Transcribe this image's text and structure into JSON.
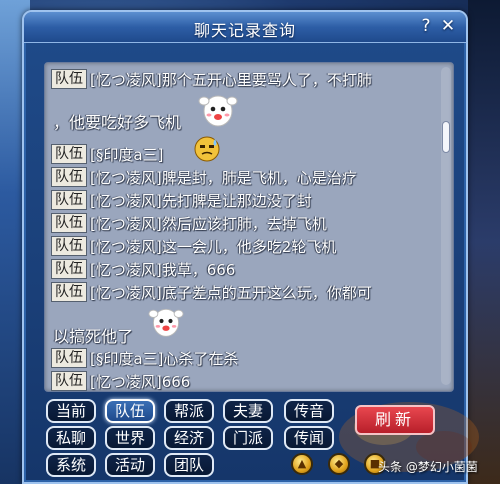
{
  "window": {
    "title": "聊天记录查询",
    "help_label": "?",
    "close_label": "✕"
  },
  "chat": {
    "lines": [
      {
        "channel": "队伍",
        "text": "[忆つ凌风]那个五开心里要骂人了，不打肺"
      },
      {
        "continuation": "，他要吃好多飞机"
      },
      {
        "channel": "队伍",
        "text": "[§印度a三]"
      },
      {
        "channel": "队伍",
        "text": "[忆つ凌风]脾是封，肺是飞机，心是治疗"
      },
      {
        "channel": "队伍",
        "text": "[忆つ凌风]先打脾是让那边没了封"
      },
      {
        "channel": "队伍",
        "text": "[忆つ凌风]然后应该打肺，去掉飞机"
      },
      {
        "channel": "队伍",
        "text": "[忆つ凌风]这一会儿，他多吃2轮飞机"
      },
      {
        "channel": "队伍",
        "text": "[忆つ凌风]我草，666"
      },
      {
        "channel": "队伍",
        "text": "[忆つ凌风]底子差点的五开这么玩，你都可"
      },
      {
        "continuation": "以搞死他了"
      },
      {
        "channel": "队伍",
        "text": "[§印度a三]心杀了在杀"
      },
      {
        "channel": "队伍",
        "text": "[忆つ凌风]666"
      }
    ],
    "emotes": [
      "cheering-ghost-emote",
      "sweating-face-emote",
      "cheering-ghost-emote"
    ]
  },
  "tabs": [
    {
      "label": "当前",
      "active": false
    },
    {
      "label": "队伍",
      "active": true
    },
    {
      "label": "帮派",
      "active": false
    },
    {
      "label": "夫妻",
      "active": false
    },
    {
      "label": "传音",
      "active": false
    },
    {
      "label": "私聊",
      "active": false
    },
    {
      "label": "世界",
      "active": false
    },
    {
      "label": "经济",
      "active": false
    },
    {
      "label": "门派",
      "active": false
    },
    {
      "label": "传闻",
      "active": false
    },
    {
      "label": "系统",
      "active": false
    },
    {
      "label": "活动",
      "active": false
    },
    {
      "label": "团队",
      "active": false
    }
  ],
  "refresh_label": "刷新",
  "bottom_icons": [
    "up-arrow-icon",
    "gold-coin-icon",
    "bag-icon"
  ],
  "watermark": "头条 @梦幻小菌菌",
  "colors": {
    "window_bg": "#1a3f78",
    "chat_bg": "#9aa6bd",
    "channel_tag_bg": "#edeae0",
    "refresh_bg": "#d0323c"
  }
}
